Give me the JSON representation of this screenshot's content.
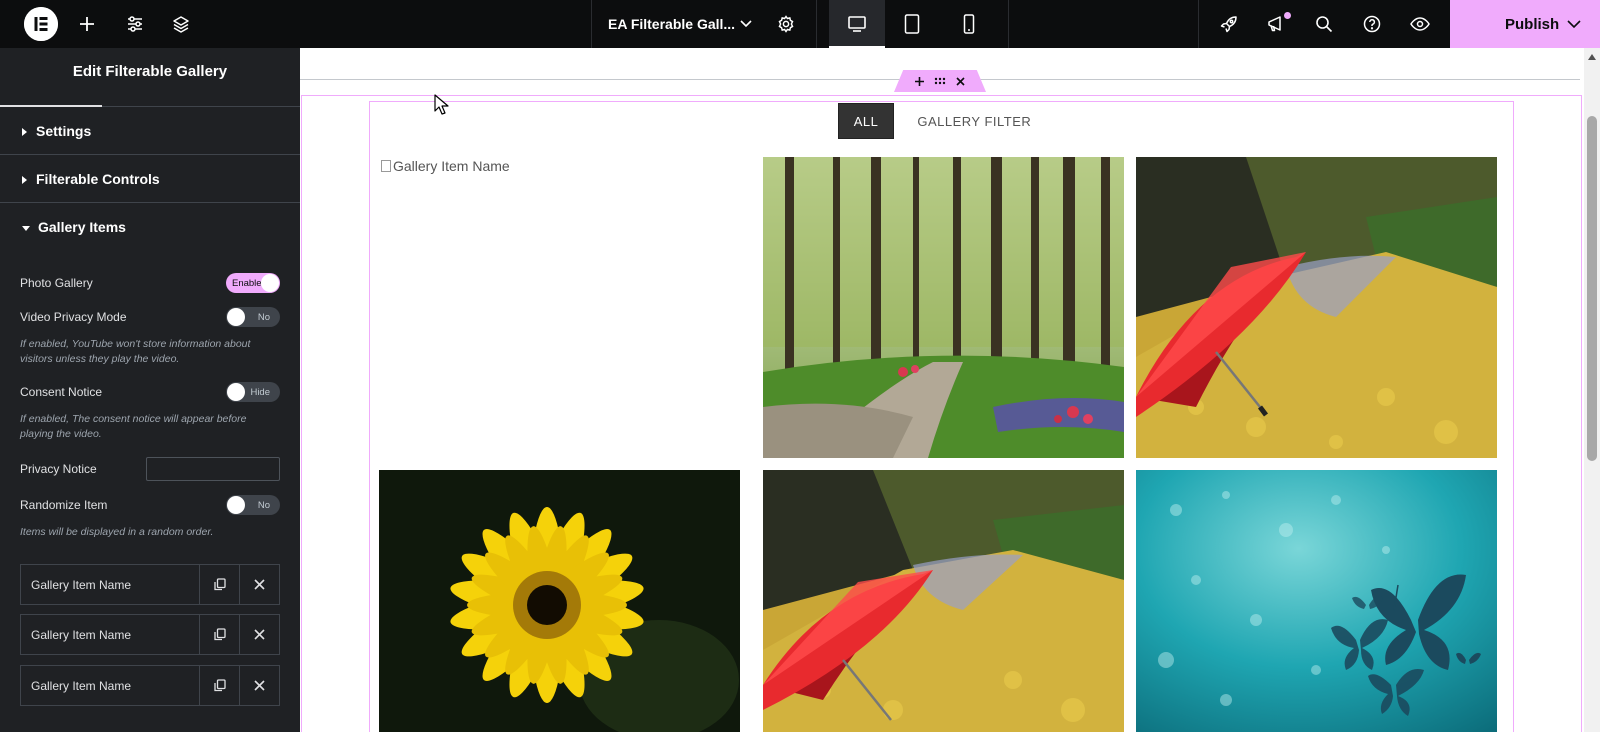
{
  "topbar": {
    "document_title": "EA Filterable Gall...",
    "publish_label": "Publish",
    "icons": [
      "elementor-logo-icon",
      "add-icon",
      "sliders-icon",
      "layers-icon",
      "chevron-down-icon",
      "gear-icon",
      "desktop-icon",
      "tablet-icon",
      "mobile-icon",
      "rocket-icon",
      "megaphone-icon",
      "search-icon",
      "help-icon",
      "eye-icon"
    ],
    "accent_color": "#f0abfc"
  },
  "panel": {
    "header_title": "Edit Filterable Gallery",
    "sections": {
      "settings": "Settings",
      "filterable_controls": "Filterable Controls",
      "gallery_items": "Gallery Items"
    },
    "controls": {
      "photo_gallery": {
        "label": "Photo Gallery",
        "state": "Enable"
      },
      "video_privacy": {
        "label": "Video Privacy Mode",
        "state": "No",
        "desc": "If enabled, YouTube won't store information about visitors unless they play the video."
      },
      "consent_notice": {
        "label": "Consent Notice",
        "state": "Hide",
        "desc": "If enabled, The consent notice will appear before playing the video."
      },
      "privacy_notice": {
        "label": "Privacy Notice",
        "value": ""
      },
      "randomize": {
        "label": "Randomize Item",
        "state": "No",
        "desc": "Items will be displayed in a random order."
      }
    },
    "repeater_items": [
      "Gallery Item Name",
      "Gallery Item Name",
      "Gallery Item Name"
    ]
  },
  "canvas": {
    "filters": [
      "ALL",
      "GALLERY FILTER"
    ],
    "active_filter": "ALL",
    "gallery": {
      "broken_item_alt": "Gallery Item Name",
      "items": [
        "forest-path-image",
        "red-umbrella-leaves-image",
        "yellow-flower-image",
        "red-umbrella-leaves-image",
        "butterflies-teal-image"
      ]
    }
  }
}
